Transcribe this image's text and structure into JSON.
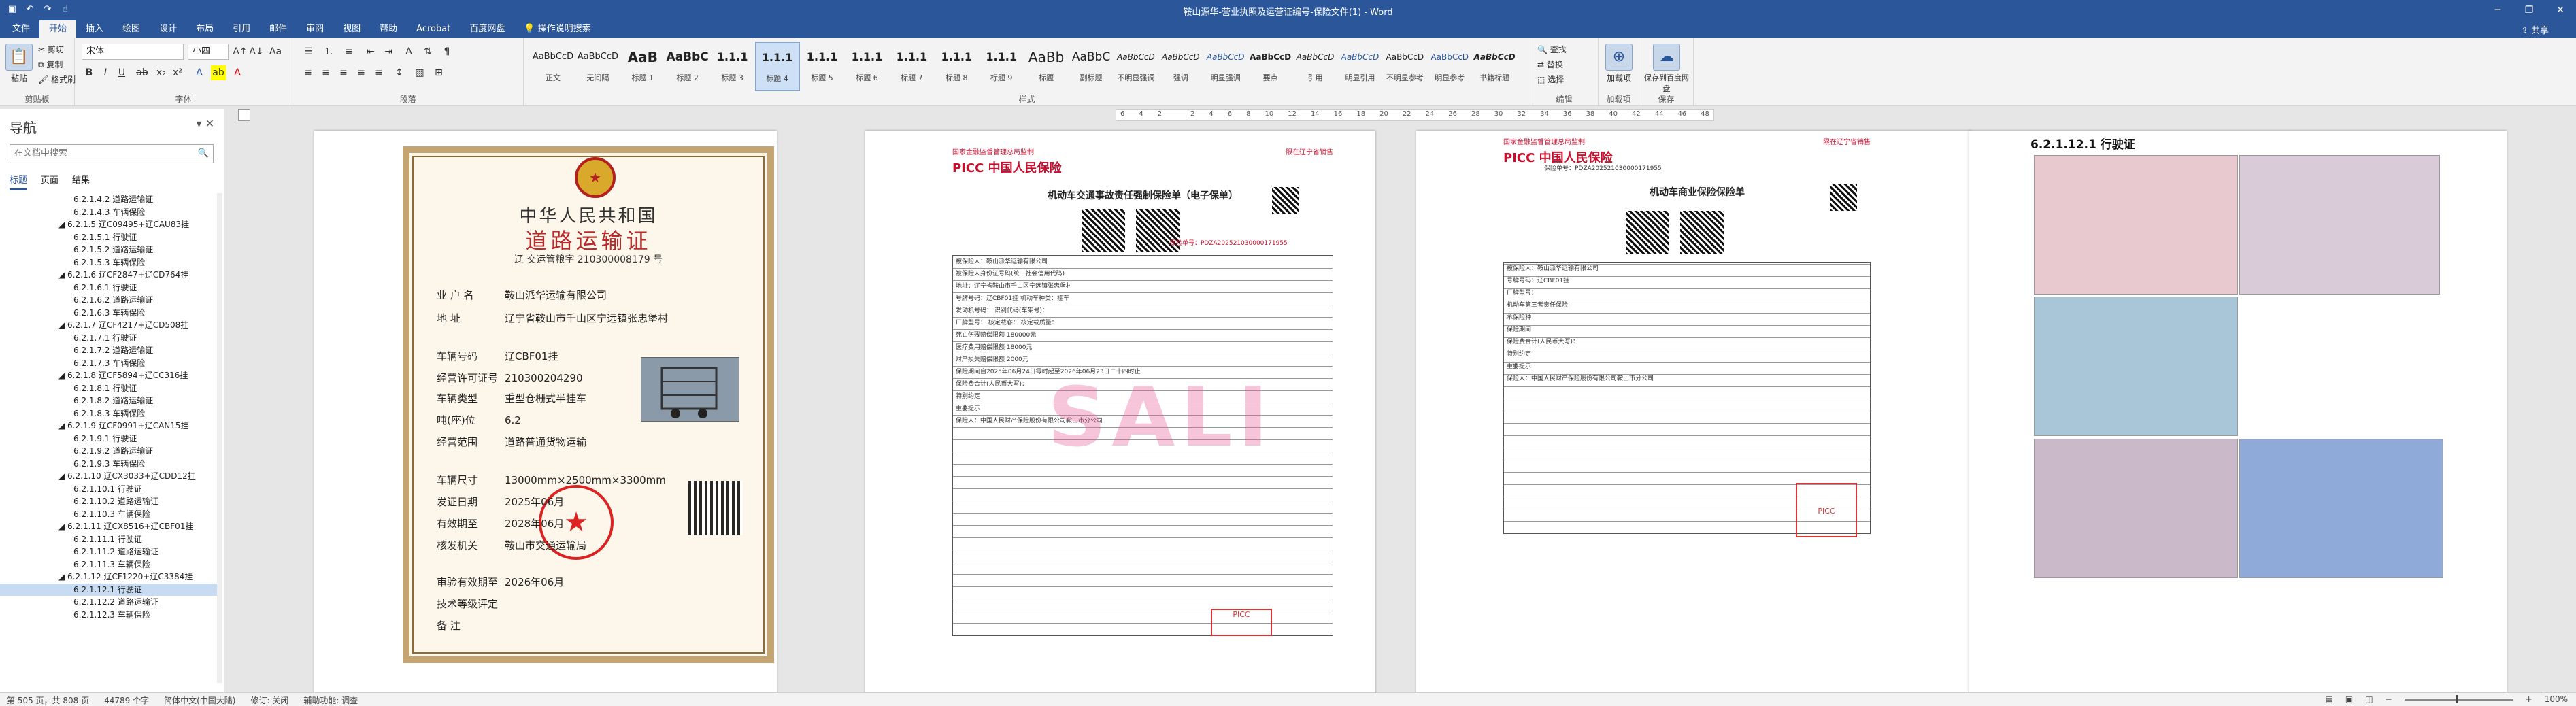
{
  "window": {
    "title": "鞍山源华-营业执照及运营证编号-保险文件(1) - Word",
    "qat": [
      "save-icon",
      "undo-icon",
      "redo-icon",
      "touch-icon"
    ],
    "controls": [
      "─",
      "❐",
      "✕"
    ]
  },
  "tabs": [
    "文件",
    "开始",
    "插入",
    "绘图",
    "设计",
    "布局",
    "引用",
    "邮件",
    "审阅",
    "视图",
    "帮助",
    "Acrobat",
    "百度网盘",
    "操作说明搜索"
  ],
  "active_tab": "开始",
  "share": "共享",
  "ribbon": {
    "clipboard": {
      "paste": "粘贴",
      "cut": "剪切",
      "copy": "复制",
      "format_painter": "格式刷",
      "label": "剪贴板"
    },
    "font": {
      "name": "宋体",
      "size": "小四",
      "label": "字体"
    },
    "paragraph": {
      "label": "段落"
    },
    "styles": {
      "label": "样式",
      "items": [
        {
          "sample": "AaBbCcD",
          "name": "正文"
        },
        {
          "sample": "AaBbCcD",
          "name": "无间隔"
        },
        {
          "sample": "AaB",
          "name": "标题 1"
        },
        {
          "sample": "AaBbC",
          "name": "标题 2"
        },
        {
          "sample": "1.1.1",
          "name": "标题 3"
        },
        {
          "sample": "1.1.1",
          "name": "标题 4"
        },
        {
          "sample": "1.1.1",
          "name": "标题 5"
        },
        {
          "sample": "1.1.1",
          "name": "标题 6"
        },
        {
          "sample": "1.1.1",
          "name": "标题 7"
        },
        {
          "sample": "1.1.1",
          "name": "标题 8"
        },
        {
          "sample": "1.1.1",
          "name": "标题 9"
        },
        {
          "sample": "AaBb",
          "name": "标题"
        },
        {
          "sample": "AaBbC",
          "name": "副标题"
        },
        {
          "sample": "AaBbCcD",
          "name": "不明显强调"
        },
        {
          "sample": "AaBbCcD",
          "name": "强调"
        },
        {
          "sample": "AaBbCcD",
          "name": "明显强调"
        },
        {
          "sample": "AaBbCcD",
          "name": "要点"
        },
        {
          "sample": "AaBbCcD",
          "name": "引用"
        },
        {
          "sample": "AaBbCcD",
          "name": "明显引用"
        },
        {
          "sample": "AaBbCcD",
          "name": "不明显参考"
        },
        {
          "sample": "AaBbCcD",
          "name": "明显参考"
        },
        {
          "sample": "AaBbCcD",
          "name": "书籍标题"
        }
      ],
      "selected": 5
    },
    "editing": {
      "find": "查找",
      "replace": "替换",
      "select": "选择",
      "label": "编辑"
    },
    "addin": {
      "name": "加载项",
      "label": "加载项"
    },
    "baidu": {
      "name": "保存到百度网盘",
      "label": "保存"
    }
  },
  "ruler": [
    "6",
    "4",
    "2",
    "",
    "2",
    "4",
    "6",
    "8",
    "10",
    "12",
    "14",
    "16",
    "18",
    "20",
    "22",
    "24",
    "26",
    "28",
    "30",
    "32",
    "34",
    "36",
    "38",
    "40",
    "42",
    "44",
    "46",
    "48"
  ],
  "nav": {
    "title": "导航",
    "search_placeholder": "在文档中搜索",
    "tabs": [
      "标题",
      "页面",
      "结果"
    ],
    "items": [
      "6.2.1.4.2 道路运输证",
      "6.2.1.4.3 车辆保险",
      "◢ 6.2.1.5 辽C09495+辽CAU83挂",
      "6.2.1.5.1 行驶证",
      "6.2.1.5.2 道路运输证",
      "6.2.1.5.3 车辆保险",
      "◢ 6.2.1.6 辽CF2847+辽CD764挂",
      "6.2.1.6.1 行驶证",
      "6.2.1.6.2 道路运输证",
      "6.2.1.6.3 车辆保险",
      "◢ 6.2.1.7 辽CF4217+辽CD508挂",
      "6.2.1.7.1 行驶证",
      "6.2.1.7.2 道路运输证",
      "6.2.1.7.3 车辆保险",
      "◢ 6.2.1.8 辽CF5894+辽CC316挂",
      "6.2.1.8.1 行驶证",
      "6.2.1.8.2 道路运输证",
      "6.2.1.8.3 车辆保险",
      "◢ 6.2.1.9 辽CF0991+辽CAN15挂",
      "6.2.1.9.1 行驶证",
      "6.2.1.9.2 道路运输证",
      "6.2.1.9.3 车辆保险",
      "◢ 6.2.1.10 辽CX3033+辽CDD12挂",
      "6.2.1.10.1 行驶证",
      "6.2.1.10.2 道路运输证",
      "6.2.1.10.3 车辆保险",
      "◢ 6.2.1.11 辽CX8516+辽CBF01挂",
      "6.2.1.11.1 行驶证",
      "6.2.1.11.2 道路运输证",
      "6.2.1.11.3 车辆保险",
      "◢ 6.2.1.12 辽CF1220+辽C3384挂",
      "6.2.1.12.1 行驶证",
      "6.2.1.12.2 道路运输证",
      "6.2.1.12.3 车辆保险"
    ],
    "selected_index": 31
  },
  "page1": {
    "h1": "中华人民共和国",
    "h2": "道路运输证",
    "certno": "辽    交运管粮字 210300008179 号",
    "rows": [
      {
        "k": "业 户 名",
        "v": "鞍山派华运输有限公司"
      },
      {
        "k": "地    址",
        "v": "辽宁省鞍山市千山区宁远镇张忠堡村"
      },
      {
        "k": "车辆号码",
        "v": "辽CBF01挂"
      },
      {
        "k": "经营许可证号",
        "v": "210300204290"
      },
      {
        "k": "车辆类型",
        "v": "重型仓栅式半挂车"
      },
      {
        "k": "吨(座)位",
        "v": "6.2"
      },
      {
        "k": "经营范围",
        "v": "道路普通货物运输"
      },
      {
        "k": "车辆尺寸",
        "v": "13000mm×2500mm×3300mm"
      },
      {
        "k": "发证日期",
        "v": "2025年06月"
      },
      {
        "k": "有效期至",
        "v": "2028年06月"
      },
      {
        "k": "核发机关",
        "v": "鞍山市交通运输局"
      },
      {
        "k": "审验有效期至",
        "v": "2026年06月"
      },
      {
        "k": "技术等级评定",
        "v": ""
      },
      {
        "k": "备    注",
        "v": ""
      }
    ]
  },
  "page2": {
    "redtop": "国家金融监督管理总局监制",
    "redright": "限在辽宁省销售",
    "logo": "PICC 中国人民保险",
    "title": "机动车交通事故责任强制保险单（电子保单）",
    "policyno": "保险单号：PDZA202521030000171955",
    "watermark": "SALI",
    "lines": [
      "被保险人：鞍山派华运输有限公司",
      "被保险人身份证号码(统一社会信用代码)",
      "地址：辽宁省鞍山市千山区宁远镇张忠堡村",
      "号牌号码：辽CBF01挂   机动车种类：挂车",
      "发动机号码：       识别代码(车架号)：",
      "厂牌型号：       核定载客：   核定载质量：",
      "死亡伤残赔偿限额  180000元",
      "医疗费用赔偿限额  18000元",
      "财产损失赔偿限额  2000元",
      "保险期间自2025年06月24日零时起至2026年06月23日二十四时止",
      "保险费合计(人民币大写)：",
      "特别约定",
      "重要提示",
      "保险人：中国人民财产保险股份有限公司鞍山市分公司"
    ]
  },
  "page3": {
    "redtop": "国家金融监督管理总局监制",
    "redright": "限在辽宁省销售",
    "logo": "PICC 中国人民保险",
    "title": "机动车商业保险保险单",
    "policyno": "保险单号：PDZA202521030000171955",
    "lines": [
      "被保险人：鞍山派华运输有限公司",
      "号牌号码：辽CBF01挂",
      "厂牌型号：",
      "机动车第三者责任保险",
      "承保险种",
      "保险期间",
      "保险费合计(人民币大写)：",
      "特别约定",
      "重要提示",
      "保险人：中国人民财产保险股份有限公司鞍山市分公司"
    ]
  },
  "page4": {
    "heading": "6.2.1.12.1 行驶证"
  },
  "status": {
    "page": "第 505 页，共 808 页",
    "words": "44789 个字",
    "lang": "简体中文(中国大陆)",
    "track": "修订: 关闭",
    "access": "辅助功能: 调查",
    "zoom": "100%"
  }
}
